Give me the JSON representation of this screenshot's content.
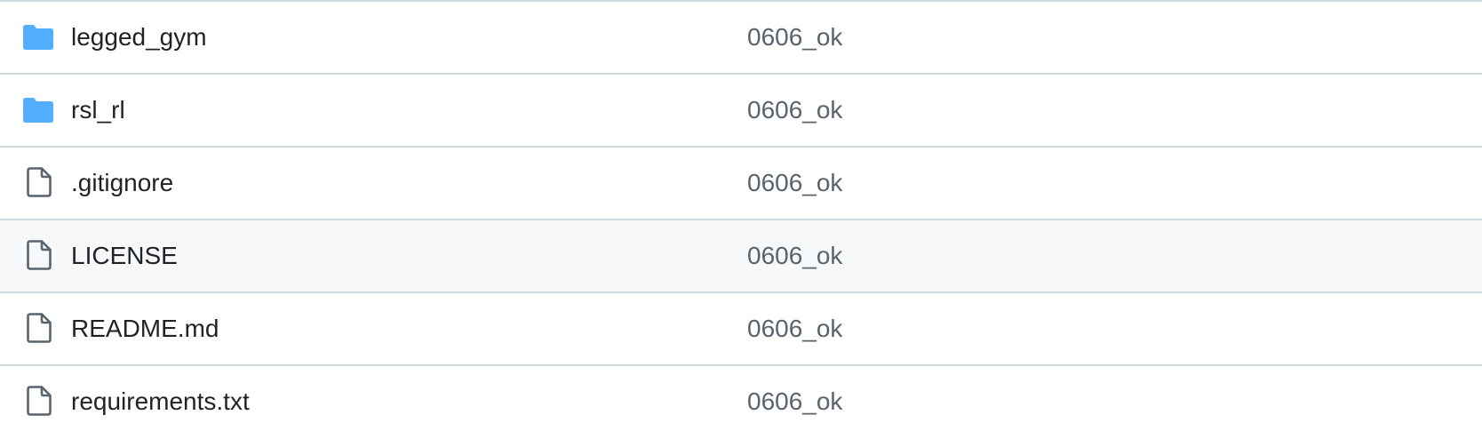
{
  "file_list": {
    "colors": {
      "folder_icon": "#54aeff",
      "file_icon": "#59636e",
      "name_text": "#1f2328",
      "commit_text": "#59636e",
      "divider": "#d0d7de",
      "hover_row": "#f6f8fa"
    },
    "rows": [
      {
        "type": "folder",
        "icon": "folder-icon",
        "name": "legged_gym",
        "commit": "0606_ok"
      },
      {
        "type": "folder",
        "icon": "folder-icon",
        "name": "rsl_rl",
        "commit": "0606_ok"
      },
      {
        "type": "file",
        "icon": "file-icon",
        "name": ".gitignore",
        "commit": "0606_ok"
      },
      {
        "type": "file",
        "icon": "file-icon",
        "name": "LICENSE",
        "commit": "0606_ok",
        "hovered": true
      },
      {
        "type": "file",
        "icon": "file-icon",
        "name": "README.md",
        "commit": "0606_ok"
      },
      {
        "type": "file",
        "icon": "file-icon",
        "name": "requirements.txt",
        "commit": "0606_ok"
      }
    ]
  }
}
